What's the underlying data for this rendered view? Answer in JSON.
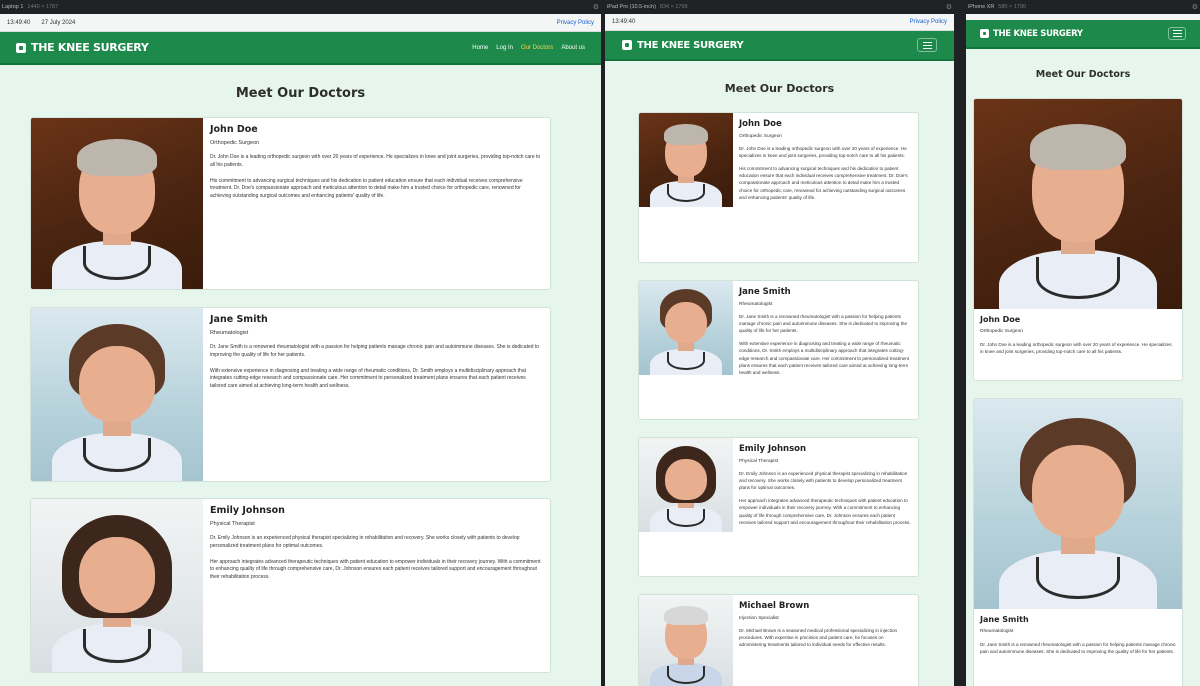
{
  "frames": [
    {
      "name": "Laptop 1",
      "size": "1440 × 1787"
    },
    {
      "name": "iPad Pro (10.5-inch)",
      "size": "834 × 1799"
    },
    {
      "name": "iPhone XR",
      "size": "580 × 1790"
    }
  ],
  "topbar": {
    "time": "13:49:40",
    "date": "27 July 2024",
    "privacy": "Privacy Policy"
  },
  "brand": {
    "name": "THE KNEE SURGERY"
  },
  "nav": {
    "home": "Home",
    "login": "Log In",
    "doctors": "Our Doctors",
    "about": "About us"
  },
  "page": {
    "heading": "Meet Our Doctors"
  },
  "colors": {
    "primary": "#1d8a4c",
    "background": "#e6f6ed",
    "active_link": "#f5d547"
  },
  "doctors": [
    {
      "name": "John Doe",
      "specialty": "Orthopedic Surgeon",
      "p1": "Dr. John Doe is a leading orthopedic surgeon with over 20 years of experience. He specializes in knee and joint surgeries, providing top-notch care to all his patients.",
      "p2": "His commitment to advancing surgical techniques and his dedication to patient education ensure that each individual receives comprehensive treatment. Dr. Doe's compassionate approach and meticulous attention to detail make him a trusted choice for orthopedic care, renowned for achieving outstanding surgical outcomes and enhancing patients' quality of life."
    },
    {
      "name": "Jane Smith",
      "specialty": "Rheumatologist",
      "p1": "Dr. Jane Smith is a renowned rheumatologist with a passion for helping patients manage chronic pain and autoimmune diseases. She is dedicated to improving the quality of life for her patients.",
      "p2": "With extensive experience in diagnosing and treating a wide range of rheumatic conditions, Dr. Smith employs a multidisciplinary approach that integrates cutting-edge research and compassionate care. Her commitment to personalized treatment plans ensures that each patient receives tailored care aimed at achieving long-term health and wellness."
    },
    {
      "name": "Emily Johnson",
      "specialty": "Physical Therapist",
      "p1": "Dr. Emily Johnson is an experienced physical therapist specializing in rehabilitation and recovery. She works closely with patients to develop personalized treatment plans for optimal outcomes.",
      "p2": "Her approach integrates advanced therapeutic techniques with patient education to empower individuals in their recovery journey. With a commitment to enhancing quality of life through comprehensive care, Dr. Johnson ensures each patient receives tailored support and encouragement throughout their rehabilitation process."
    },
    {
      "name": "Michael Brown",
      "specialty": "Injection Specialist",
      "p1": "Dr. Michael Brown is a seasoned medical professional specializing in injection procedures. With expertise in precision and patient care, he focuses on administering treatments tailored to individual needs for effective results."
    }
  ]
}
